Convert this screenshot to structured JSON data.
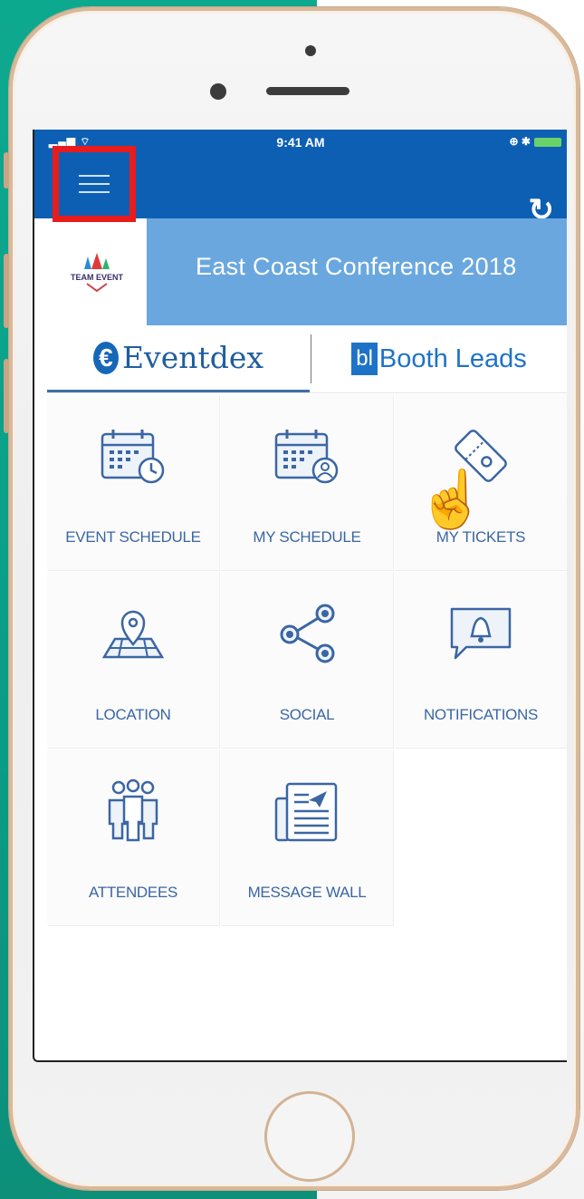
{
  "status_bar": {
    "signal": "▂▄▆ ⌔",
    "time": "9:41 AM",
    "right": "⊕ ✱"
  },
  "header": {
    "menu_icon": "hamburger-icon",
    "refresh_icon": "refresh-icon",
    "refresh_glyph": "↻"
  },
  "banner": {
    "logo_text": "TEAM EVENT",
    "title": "East Coast Conference 2018"
  },
  "tabs": [
    {
      "mark": "€",
      "label": "Eventdex",
      "active": true
    },
    {
      "mark": "bl",
      "label": "Booth Leads",
      "active": false
    }
  ],
  "pointer": {
    "icon": "hand-pointer-icon",
    "glyph": "☝"
  },
  "tiles": [
    {
      "label": "EVENT SCHEDULE",
      "icon": "calendar-clock-icon"
    },
    {
      "label": "MY SCHEDULE",
      "icon": "calendar-user-icon"
    },
    {
      "label": "MY TICKETS",
      "icon": "ticket-icon"
    },
    {
      "label": "LOCATION",
      "icon": "map-pin-icon"
    },
    {
      "label": "SOCIAL",
      "icon": "share-icon"
    },
    {
      "label": "NOTIFICATIONS",
      "icon": "bell-icon"
    },
    {
      "label": "ATTENDEES",
      "icon": "people-icon"
    },
    {
      "label": "MESSAGE WALL",
      "icon": "newspaper-icon"
    }
  ],
  "colors": {
    "primary": "#0d5fb3",
    "banner": "#6aa7df",
    "highlight": "#e81c1c",
    "tile_text": "#3b66a3"
  }
}
